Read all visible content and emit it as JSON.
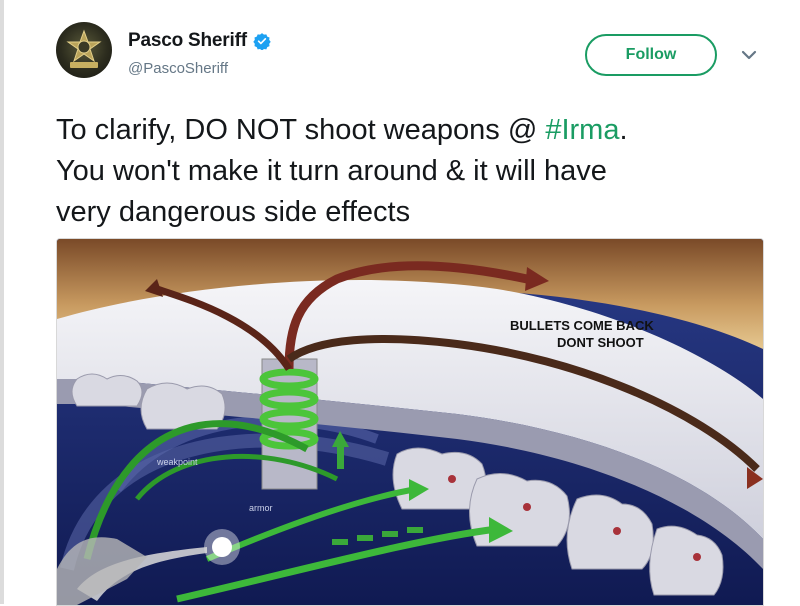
{
  "tweet": {
    "author": {
      "display_name": "Pasco Sheriff",
      "handle": "@PascoSheriff",
      "verified": true,
      "avatar_icon": "sheriff-badge-icon"
    },
    "follow_label": "Follow",
    "menu_icon": "chevron-down-icon",
    "text": {
      "line1_prefix": "To clarify, DO NOT shoot weapons @ ",
      "hashtag": "#Irma",
      "line1_suffix": ".",
      "line2": "You won't make it turn around & it will have",
      "line3": "very dangerous side effects"
    },
    "media": {
      "caption_line1": "BULLETS COME BACK",
      "caption_line2": "DONT SHOOT",
      "label_weakpoint": "weakpoint",
      "label_armor": "armor"
    }
  },
  "colors": {
    "accent": "#1a9c63",
    "verified": "#1da1f2",
    "text": "#14171a",
    "muted": "#657786"
  }
}
